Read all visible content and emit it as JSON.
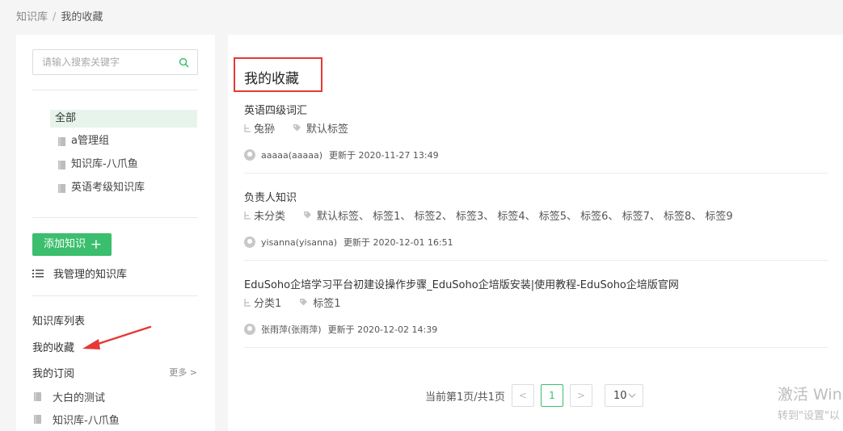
{
  "breadcrumb": {
    "root": "知识库",
    "separator": "/",
    "current": "我的收藏"
  },
  "sidebar": {
    "search_placeholder": "请输入搜索关键字",
    "tree": {
      "all": "全部",
      "items": [
        "a管理组",
        "知识库-八爪鱼",
        "英语考级知识库"
      ]
    },
    "add_button": "添加知识",
    "add_plus": "+",
    "manage_link": "我管理的知识库",
    "library_list": "知识库列表",
    "favorites": "我的收藏",
    "subscriptions": "我的订阅",
    "more": "更多 >",
    "subscription_items": [
      "大白的测试",
      "知识库-八爪鱼"
    ]
  },
  "main": {
    "title": "我的收藏",
    "entries": [
      {
        "name": "英语四级词汇",
        "category": "兔狲",
        "tags": "默认标签",
        "author": "aaaaa(aaaaa)",
        "updated": "更新于 2020-11-27 13:49"
      },
      {
        "name": "负责人知识",
        "category": "未分类",
        "tags": "默认标签、 标签1、 标签2、 标签3、 标签4、 标签5、 标签6、 标签7、 标签8、 标签9",
        "author": "yisanna(yisanna)",
        "updated": "更新于 2020-12-01 16:51"
      },
      {
        "name": "EduSoho企培学习平台初建设操作步骤_EduSoho企培版安装|使用教程-EduSoho企培版官网",
        "category": "分类1",
        "tags": "标签1",
        "author": "张雨萍(张雨萍)",
        "updated": "更新于 2020-12-02 14:39"
      }
    ],
    "pagination": {
      "info": "当前第1页/共1页",
      "prev": "<",
      "page": "1",
      "next": ">",
      "size": "10"
    }
  },
  "watermark": {
    "line1": "激活 Win",
    "line2": "转到\"设置\"以"
  },
  "colors": {
    "accent": "#3bbe6d",
    "highlight_border": "#e53935"
  }
}
